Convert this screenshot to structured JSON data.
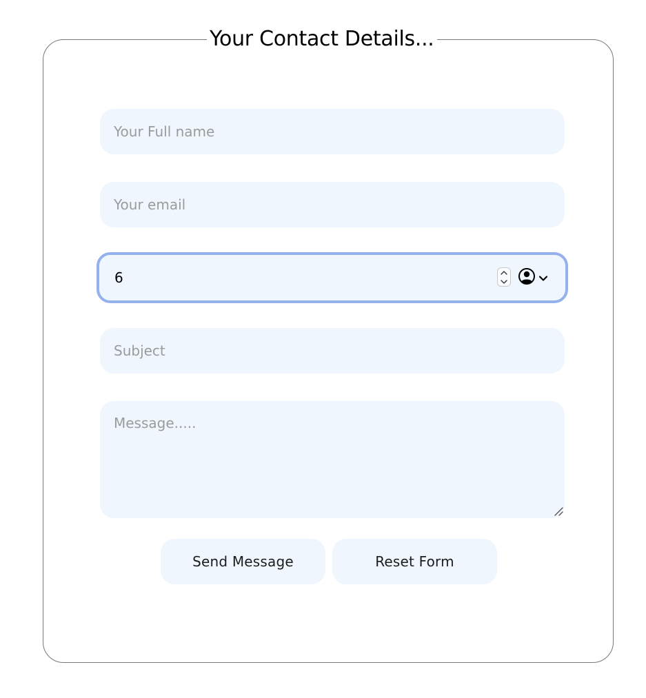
{
  "form": {
    "legend": "Your Contact Details...",
    "fields": {
      "full_name": {
        "placeholder": "Your Full name",
        "value": ""
      },
      "email": {
        "placeholder": "Your email",
        "value": ""
      },
      "number": {
        "value": "6"
      },
      "subject": {
        "placeholder": "Subject",
        "value": ""
      },
      "message": {
        "placeholder": "Message.....",
        "value": ""
      }
    },
    "buttons": {
      "send": "Send Message",
      "reset": "Reset Form"
    }
  },
  "icons": {
    "spinner_up": "chevron-up-icon",
    "spinner_down": "chevron-down-icon",
    "contact_picker": "person-circle-icon",
    "dropdown": "chevron-down-icon"
  },
  "colors": {
    "field_background": "#eff6fd",
    "focus_ring": "#94b1ee",
    "border": "#777777",
    "placeholder": "#9b9b9b"
  }
}
